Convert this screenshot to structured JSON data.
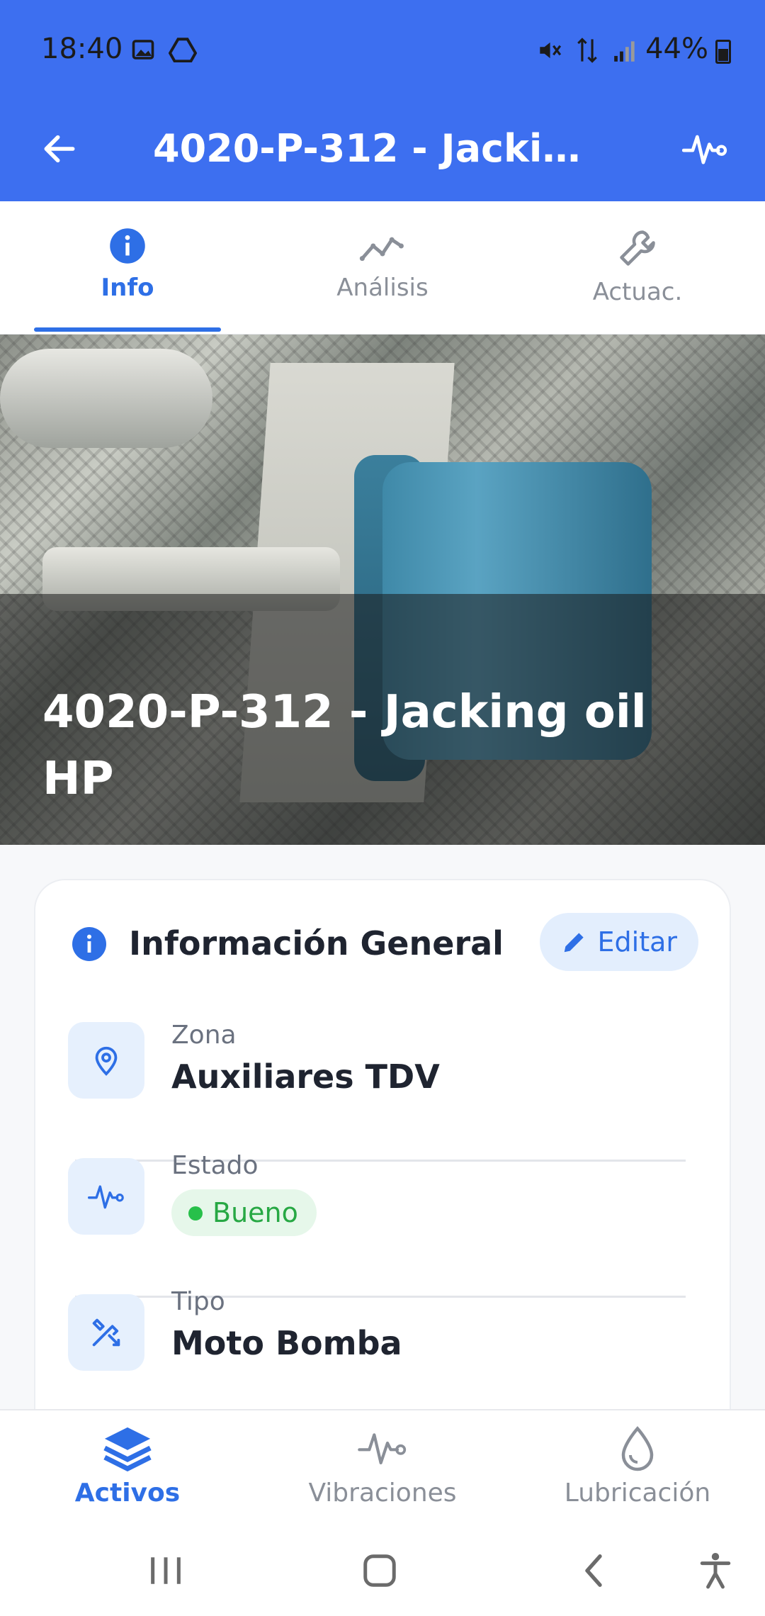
{
  "status_bar": {
    "time": "18:40",
    "battery": "44%"
  },
  "app_bar": {
    "title": "4020-P-312 - Jacking…"
  },
  "tabs": [
    {
      "label": "Info",
      "icon": "info-icon",
      "active": true
    },
    {
      "label": "Análisis",
      "icon": "trend-icon",
      "active": false
    },
    {
      "label": "Actuac.",
      "icon": "wrench-icon",
      "active": false
    }
  ],
  "hero": {
    "title": "4020-P-312 - Jacking oil HP"
  },
  "card": {
    "title": "Información General",
    "edit_label": "Editar",
    "rows": [
      {
        "label": "Zona",
        "value": "Auxiliares TDV",
        "icon": "location-pin-icon"
      },
      {
        "label": "Estado",
        "value": "Bueno",
        "icon": "pulse-icon",
        "badge_color": "#27a844"
      },
      {
        "label": "Tipo",
        "value": "Moto Bomba",
        "icon": "tools-icon"
      }
    ]
  },
  "bottom_nav": [
    {
      "label": "Activos",
      "icon": "layers-icon",
      "active": true
    },
    {
      "label": "Vibraciones",
      "icon": "vibration-icon",
      "active": false
    },
    {
      "label": "Lubricación",
      "icon": "drop-icon",
      "active": false
    }
  ],
  "colors": {
    "primary": "#3d6ff0",
    "accent": "#2e6fe6",
    "good": "#27a844"
  }
}
